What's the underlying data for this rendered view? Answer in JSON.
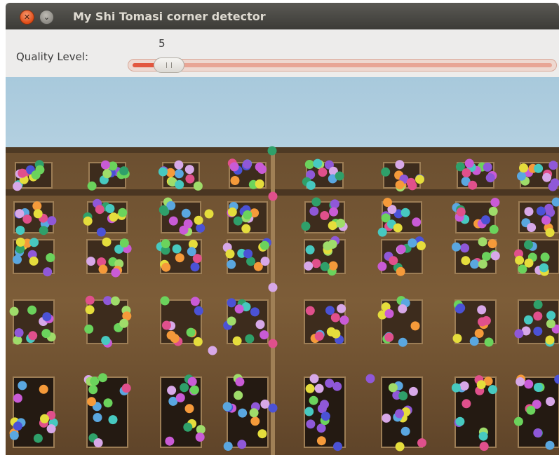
{
  "window": {
    "title": "My Shi Tomasi corner detector",
    "close_icon": "close-icon",
    "minimize_icon": "minimize-icon",
    "close_glyph": "✕",
    "minimize_glyph": "⌄"
  },
  "toolbar": {
    "quality_label": "Quality Level:",
    "slider_value": "5",
    "slider_fraction": 0.05,
    "slider_fill_color": "#e2573f"
  },
  "image": {
    "description_icon": "building-facade-image",
    "corner_marker_colors": [
      "#c95bd6",
      "#e5dd3c",
      "#6bd35c",
      "#5aa7e0",
      "#8f58d8",
      "#2fa06a",
      "#e0508c",
      "#47c9c0",
      "#f59a3a",
      "#4b52d6",
      "#9fdc6a",
      "#d7a8e8"
    ]
  }
}
